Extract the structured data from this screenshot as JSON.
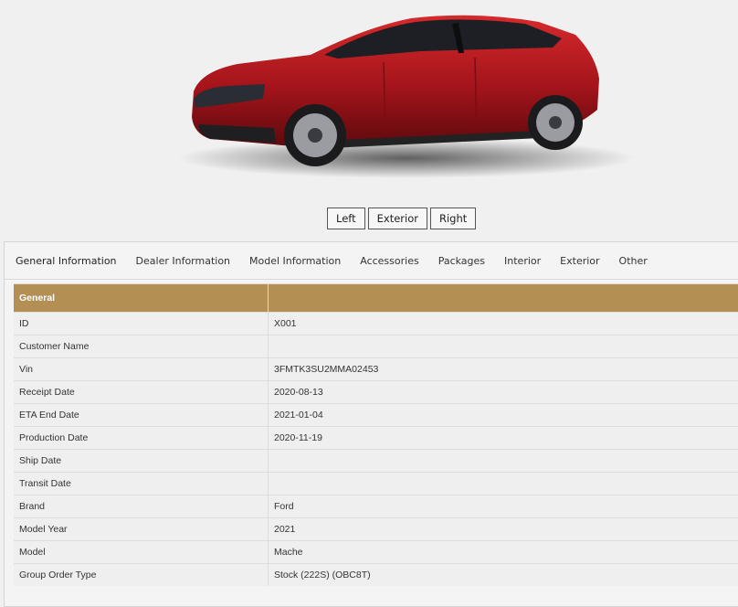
{
  "view_buttons": [
    "Left",
    "Exterior",
    "Right"
  ],
  "tabs": [
    "General Information",
    "Dealer Information",
    "Model Information",
    "Accessories",
    "Packages",
    "Interior",
    "Exterior",
    "Other"
  ],
  "table": {
    "section": "General",
    "rows": [
      {
        "label": "ID",
        "value": "X001"
      },
      {
        "label": "Customer Name",
        "value": ""
      },
      {
        "label": "Vin",
        "value": "3FMTK3SU2MMA02453"
      },
      {
        "label": "Receipt Date",
        "value": "2020-08-13"
      },
      {
        "label": "ETA End Date",
        "value": "2021-01-04"
      },
      {
        "label": "Production Date",
        "value": "2020-11-19"
      },
      {
        "label": "Ship Date",
        "value": ""
      },
      {
        "label": "Transit Date",
        "value": ""
      },
      {
        "label": "Brand",
        "value": "Ford"
      },
      {
        "label": "Model Year",
        "value": "2021"
      },
      {
        "label": "Model",
        "value": "Mache"
      },
      {
        "label": "Group Order Type",
        "value": "Stock (222S) (OBC8T)"
      }
    ]
  },
  "colors": {
    "header_gold": "#b38f54",
    "car_red": "#b3161c"
  }
}
